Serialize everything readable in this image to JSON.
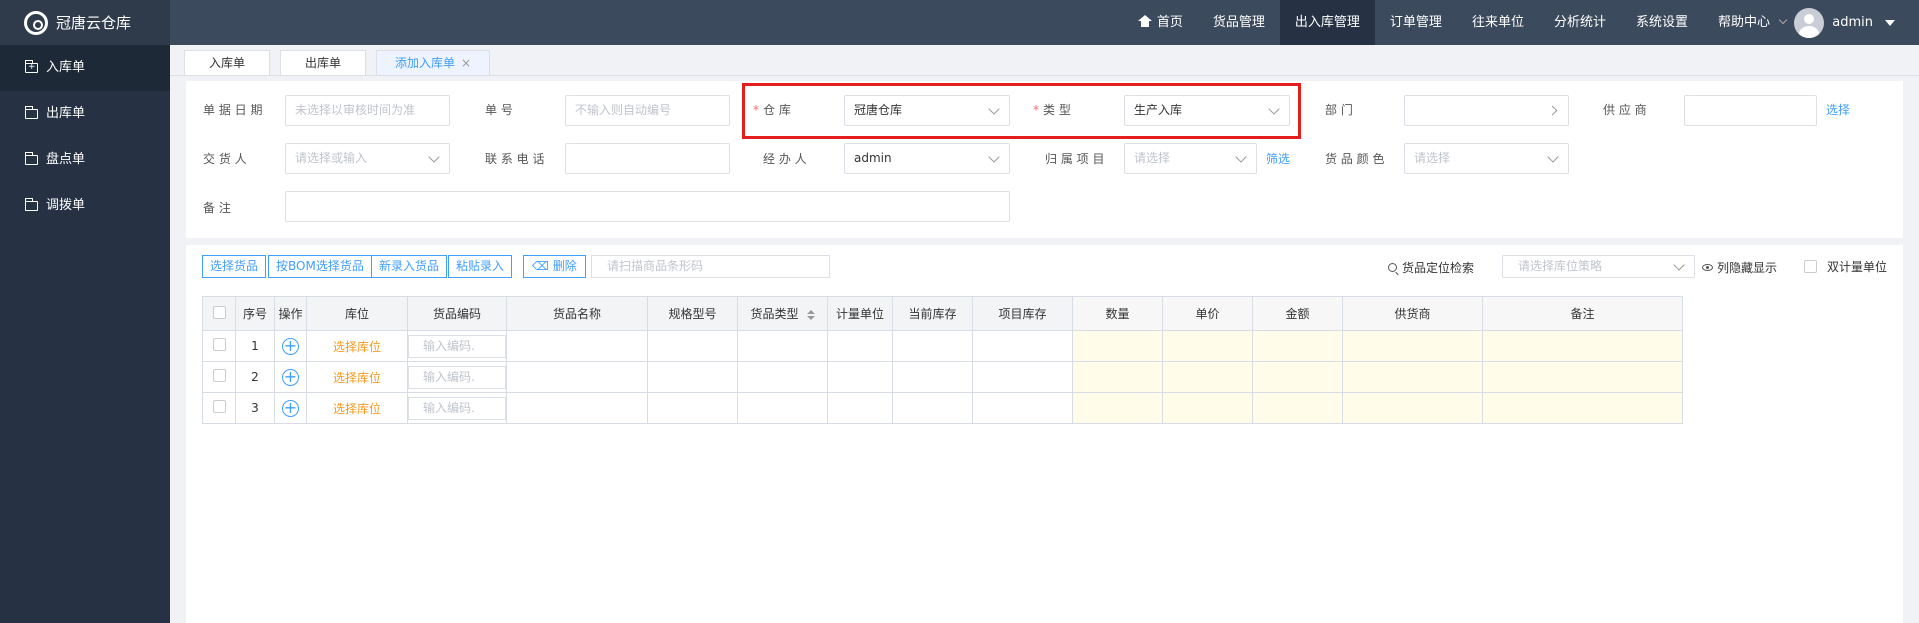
{
  "app": {
    "title": "冠唐云仓库"
  },
  "nav": {
    "items": [
      "首页",
      "货品管理",
      "出入库管理",
      "订单管理",
      "往来单位",
      "分析统计",
      "系统设置",
      "帮助中心"
    ]
  },
  "user": {
    "name": "admin"
  },
  "sidebar": {
    "items": [
      "入库单",
      "出库单",
      "盘点单",
      "调拨单"
    ]
  },
  "tabs": {
    "items": [
      "入库单",
      "出库单",
      "添加入库单"
    ],
    "close": "×"
  },
  "form": {
    "doc_date_label": "单 据 日 期",
    "doc_date_ph": "未选择以审核时间为准",
    "doc_no_label": "单          号",
    "doc_no_ph": "不输入则自动编号",
    "warehouse_label": "仓          库",
    "warehouse_value": "冠唐仓库",
    "type_label": "类          型",
    "type_value": "生产入库",
    "dept_label": "部          门",
    "supplier_label": "供   应   商",
    "supplier_link": "选择",
    "deliverer_label": "交   货   人",
    "deliverer_ph": "请选择或输入",
    "phone_label": "联 系 电 话",
    "handler_label": "经   办   人",
    "handler_value": "admin",
    "project_label": "归 属 项 目",
    "project_ph": "请选择",
    "project_link": "筛选",
    "color_label": "货 品 颜 色",
    "color_ph": "请选择",
    "remark_label": "备          注",
    "required_mark": "*"
  },
  "toolbar": {
    "select_goods": "选择货品",
    "bom_select": "按BOM选择货品",
    "new_goods": "新录入货品",
    "paste_entry": "粘贴录入",
    "delete": "删除",
    "scan_ph": "请扫描商品条形码",
    "locate": "货品定位检索",
    "strategy_ph": "请选择库位策略",
    "hidden_cols": "列隐藏显示",
    "dual_unit": "双计量单位"
  },
  "table": {
    "headers": [
      "序号",
      "操作",
      "库位",
      "货品编码",
      "货品名称",
      "规格型号",
      "货品类型",
      "计量单位",
      "当前库存",
      "项目库存",
      "数量",
      "单价",
      "金额",
      "供货商",
      "备注"
    ],
    "rows": [
      {
        "no": "1",
        "location": "选择库位",
        "code_ph": "输入编码."
      },
      {
        "no": "2",
        "location": "选择库位",
        "code_ph": "输入编码."
      },
      {
        "no": "3",
        "location": "选择库位",
        "code_ph": "输入编码."
      }
    ]
  },
  "colors": {
    "accent": "#409eff",
    "warning": "#f39a1e",
    "highlight": "#e41d1d",
    "topbar": "#3c4a5d",
    "sidebar": "#263244"
  },
  "icons": [
    "logo-icon",
    "home-icon",
    "chevron-down-icon",
    "avatar",
    "folder-plus-icon",
    "folder-icon",
    "close-icon",
    "plus-icon",
    "trash-icon",
    "search-icon",
    "eye-icon",
    "sort-icon"
  ]
}
